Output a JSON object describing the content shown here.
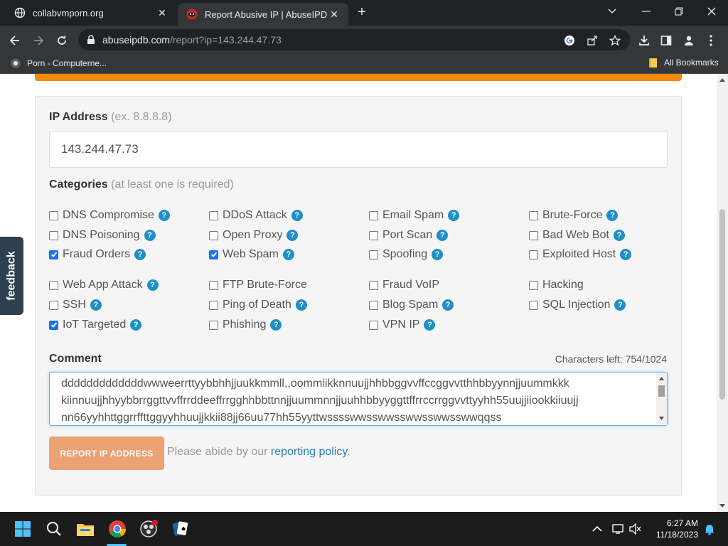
{
  "browser": {
    "tabs": [
      {
        "title": "collabvmporn.org",
        "active": false
      },
      {
        "title": "Report Abusive IP | AbuseIPDB",
        "active": true
      }
    ],
    "url_domain": "abuseipdb.com",
    "url_path": "/report?ip=143.244.47.73",
    "bookmarks": {
      "item1": "Porn - Computerne...",
      "all_bookmarks": "All Bookmarks"
    }
  },
  "form": {
    "ip_label": "IP Address",
    "ip_hint": "(ex. 8.8.8.8)",
    "ip_value": "143.244.47.73",
    "categories_label": "Categories",
    "categories_hint": "(at least one is required)",
    "categories": [
      {
        "label": "DNS Compromise",
        "checked": false
      },
      {
        "label": "DDoS Attack",
        "checked": false
      },
      {
        "label": "Email Spam",
        "checked": false
      },
      {
        "label": "Brute-Force",
        "checked": false
      },
      {
        "label": "DNS Poisoning",
        "checked": false
      },
      {
        "label": "Open Proxy",
        "checked": false
      },
      {
        "label": "Port Scan",
        "checked": false
      },
      {
        "label": "Bad Web Bot",
        "checked": false
      },
      {
        "label": "Fraud Orders",
        "checked": true
      },
      {
        "label": "Web Spam",
        "checked": true
      },
      {
        "label": "Spoofing",
        "checked": false
      },
      {
        "label": "Exploited Host",
        "checked": false
      },
      {
        "label": "Web App Attack",
        "checked": false
      },
      {
        "label": "FTP Brute-Force",
        "checked": false
      },
      {
        "label": "Fraud VoIP",
        "checked": false
      },
      {
        "label": "Hacking",
        "checked": false
      },
      {
        "label": "SSH",
        "checked": false
      },
      {
        "label": "Ping of Death",
        "checked": false
      },
      {
        "label": "Blog Spam",
        "checked": false
      },
      {
        "label": "SQL Injection",
        "checked": false
      },
      {
        "label": "IoT Targeted",
        "checked": true
      },
      {
        "label": "Phishing",
        "checked": false
      },
      {
        "label": "VPN IP",
        "checked": false
      }
    ],
    "comment_label": "Comment",
    "chars_left": "Characters left: 754/1024",
    "comment_lines": [
      "dddddddddddddwwweerrttyybbhhjjuukkmmll,,oommiikknnuujjhhbbggvvffccggvvtthhbbyynnjjuummkkk",
      "kiinnuujjhhyybbrrggttvvffrrddeeffrrgghhbbttnnjjuummnnjjuuhhbbyyggttffrrccrrggvvttyyhh55uujjiiookkiiuujj",
      "nn66yyhhttggrrffttggyyhhuujjkkii88jj66uu77hh55yyttwsssswwsswwsswwsswwsswwqqss"
    ],
    "submit_label": "REPORT IP ADDRESS",
    "policy_text": "Please abide by our",
    "policy_link": "reporting policy",
    "policy_end": "."
  },
  "feedback_label": "feedback",
  "taskbar": {
    "time": "6:27 AM",
    "date": "11/18/2023"
  },
  "colors": {
    "accent_orange": "#f28b0c",
    "button_orange": "#eba172",
    "help_blue": "#1f8fc7",
    "link_blue": "#2a7db3"
  }
}
